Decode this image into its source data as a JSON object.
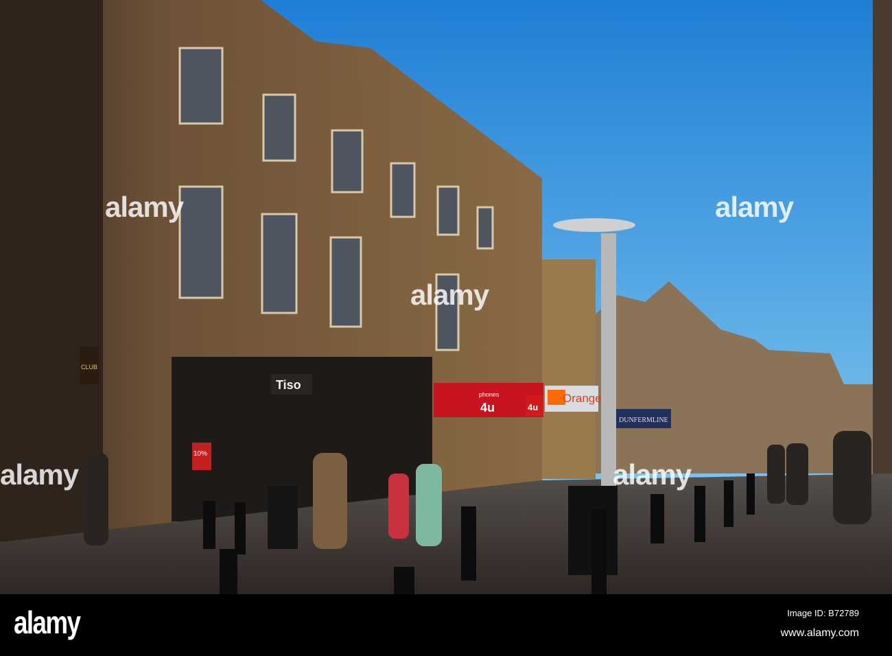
{
  "watermark": "alamy",
  "signs": {
    "tiso": "Tiso",
    "phones": "phones",
    "four_u": "4u",
    "orange": "Orange",
    "dunfermline": "DUNFERMLINE",
    "club": "CLUB",
    "discount": "10%"
  },
  "footer": {
    "logo": "alamy",
    "image_id": "Image ID: B72789",
    "website": "www.alamy.com"
  },
  "colors": {
    "sky": "#2f8fd8",
    "sandstone": "#6b5338",
    "orange_brand": "#ff6a00",
    "phones4u_red": "#c8141e"
  }
}
